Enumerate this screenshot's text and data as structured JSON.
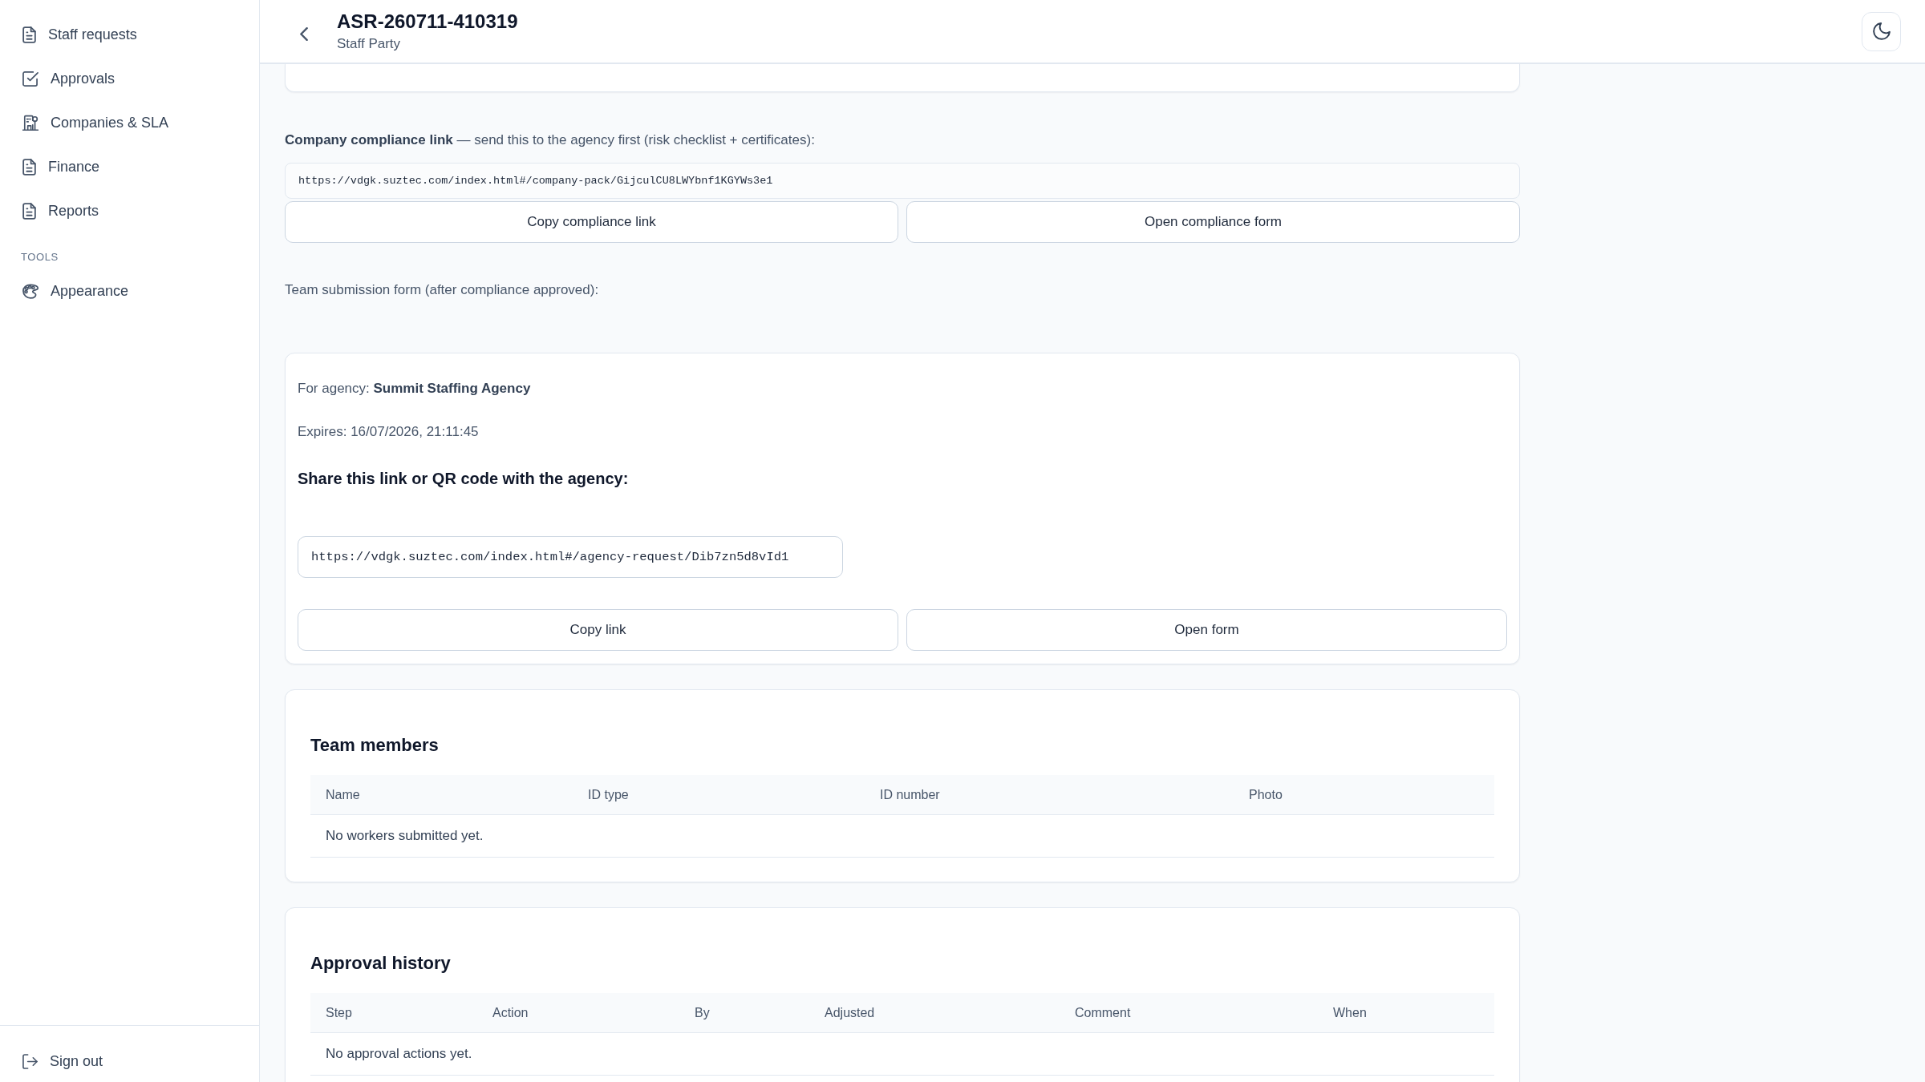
{
  "sidebar": {
    "items": [
      {
        "label": "Staff requests",
        "selected": false
      },
      {
        "label": "Approvals",
        "selected": false
      },
      {
        "label": "Companies & SLA",
        "selected": false
      },
      {
        "label": "Finance",
        "selected": false
      },
      {
        "label": "Reports",
        "selected": false
      }
    ],
    "tools": {
      "heading": "TOOLS",
      "items": [
        {
          "label": "Appearance",
          "selected": false
        }
      ]
    },
    "sign_out": "Sign out"
  },
  "header": {
    "title": "ASR-260711-410319",
    "subtitle": "Staff Party"
  },
  "compliance": {
    "intro": "**Company compliance link** — send this to the agency first (risk checklist + certificates):",
    "link": "https://vdgk.suztec.com/index.html#/company-pack/GijculCU8LWYbnf1KGYWs3e1",
    "buttons": [
      "Copy compliance link",
      "Open compliance form"
    ]
  },
  "team_submission": {
    "note": "Team submission form (after compliance approved):",
    "agency": "For agency: **Summit Staffing Agency**",
    "expires": "Expires: 16/07/2026, 21:11:45",
    "share_heading": "Share this link or QR code with the agency:",
    "link": "https://vdgk.suztec.com/index.html#/agency-request/Dib7zn5d8vId1",
    "buttons": [
      "Copy link",
      "Open form"
    ]
  },
  "team_members": {
    "title": "Team members",
    "columns": [
      "Name",
      "ID type",
      "ID number",
      "Photo"
    ],
    "empty_message": "No workers submitted yet."
  },
  "approval_history": {
    "title": "Approval history",
    "columns": [
      "Step",
      "Action",
      "By",
      "Adjusted",
      "Comment",
      "When"
    ],
    "empty_message": "No approval actions yet."
  }
}
